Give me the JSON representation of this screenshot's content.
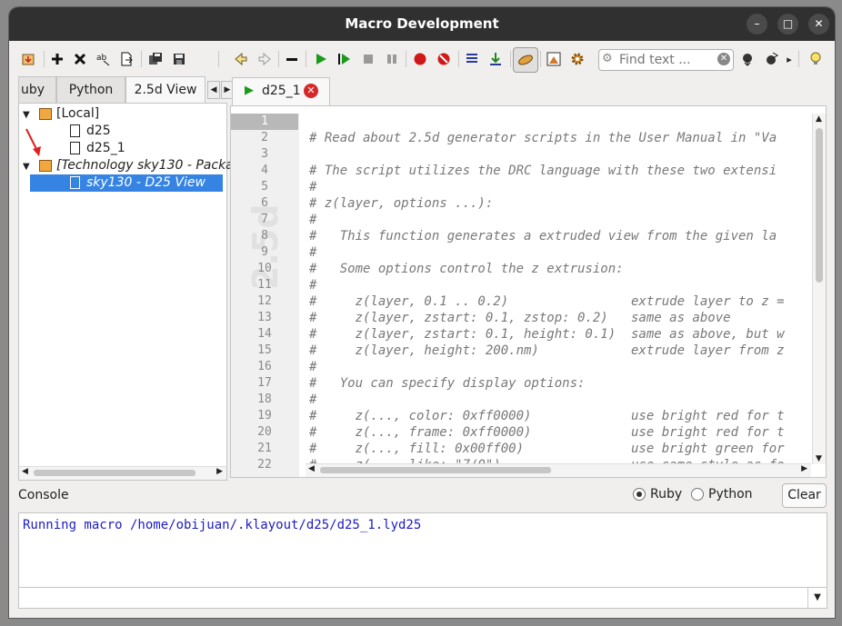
{
  "window": {
    "title": "Macro Development"
  },
  "left_tabs": [
    "uby",
    "Python",
    "2.5d View"
  ],
  "tree": {
    "local": "[Local]",
    "items": [
      "d25",
      "d25_1"
    ],
    "technology": "[Technology sky130 - Packa",
    "selected": "sky130 - D25 View"
  },
  "editor_tab": "d25_1",
  "find": {
    "placeholder": "Find text ..."
  },
  "lines": {
    "numbers": [
      "1",
      "2",
      "3",
      "4",
      "5",
      "6",
      "7",
      "8",
      "9",
      "10",
      "11",
      "12",
      "13",
      "14",
      "15",
      "16",
      "17",
      "18",
      "19",
      "20",
      "21",
      "22"
    ],
    "code": [
      "",
      "# Read about 2.5d generator scripts in the User Manual in \"Va",
      "",
      "# The script utilizes the DRC language with these two extensi",
      "#",
      "# z(layer, options ...):",
      "#",
      "#   This function generates a extruded view from the given la",
      "#",
      "#   Some options control the z extrusion:",
      "#",
      "#     z(layer, 0.1 .. 0.2)                extrude layer to z =",
      "#     z(layer, zstart: 0.1, zstop: 0.2)   same as above",
      "#     z(layer, zstart: 0.1, height: 0.1)  same as above, but w",
      "#     z(layer, height: 200.nm)            extrude layer from z",
      "#",
      "#   You can specify display options:",
      "#",
      "#     z(..., color: 0xff0000)             use bright red for t",
      "#     z(..., frame: 0xff0000)             use bright red for t",
      "#     z(..., fill: 0x00ff00)              use bright green for",
      "#     z(..., like: \"7/0\")                 use same style as fo"
    ]
  },
  "console": {
    "label": "Console",
    "radio_ruby": "Ruby",
    "radio_python": "Python",
    "clear": "Clear",
    "output": "Running macro /home/obijuan/.klayout/d25/d25_1.lyd25"
  }
}
